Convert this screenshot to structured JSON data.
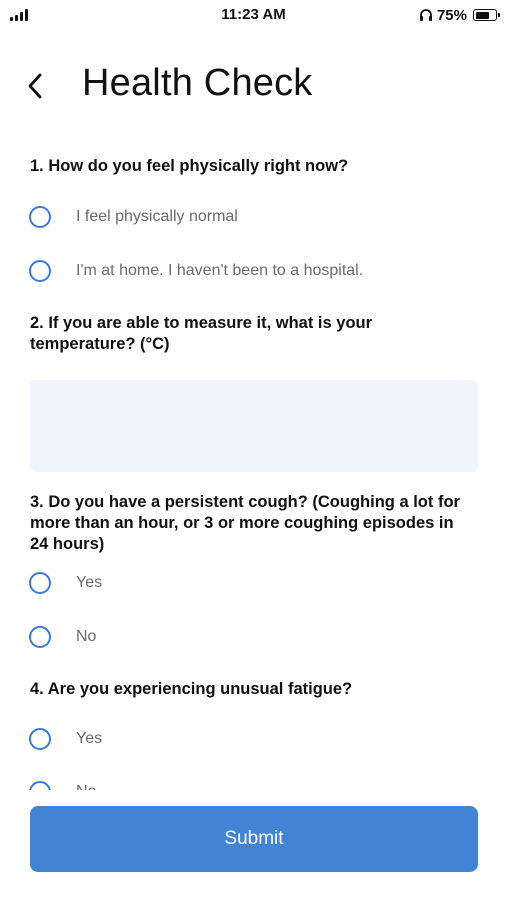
{
  "status_bar": {
    "time": "11:23 AM",
    "battery_percent": "75%",
    "battery_level": 0.75,
    "icons": [
      "signal-icon",
      "headphone-icon",
      "battery-icon"
    ]
  },
  "header": {
    "back_icon": "chevron-left-icon",
    "title": "Health Check"
  },
  "questions": [
    {
      "text": "1. How do you feel physically right now?",
      "options": [
        "I feel physically normal",
        "I'm at home. I haven't been to a hospital."
      ]
    },
    {
      "text": "2. If you are able to measure it, what is your temperature? (°C)",
      "input_value": "",
      "input_placeholder": ""
    },
    {
      "text": "3. Do you have a persistent cough? (Coughing a lot for more than an hour, or 3 or more coughing episodes in 24 hours)",
      "options": [
        "Yes",
        "No"
      ]
    },
    {
      "text": "4. Are you experiencing unusual fatigue?",
      "options": [
        "Yes",
        "No"
      ]
    }
  ],
  "submit_label": "Submit",
  "colors": {
    "accent": "#4383d4",
    "radio_border": "#3d7bd0",
    "input_background": "#eef5fd"
  }
}
